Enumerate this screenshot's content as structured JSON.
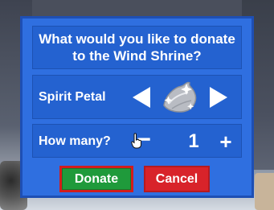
{
  "dialog": {
    "title": "What would you like to donate to the Wind Shrine?",
    "item_label": "Spirit Petal",
    "item_icon": "spirit-petal-icon",
    "quantity_label": "How many?",
    "quantity_value": "1",
    "minus_label": "−",
    "plus_label": "+",
    "donate_label": "Donate",
    "cancel_label": "Cancel"
  },
  "colors": {
    "panel": "#2f6fe0",
    "donate": "#1f9a3b",
    "cancel": "#d8232a",
    "selection_outline": "#d21c1c"
  }
}
